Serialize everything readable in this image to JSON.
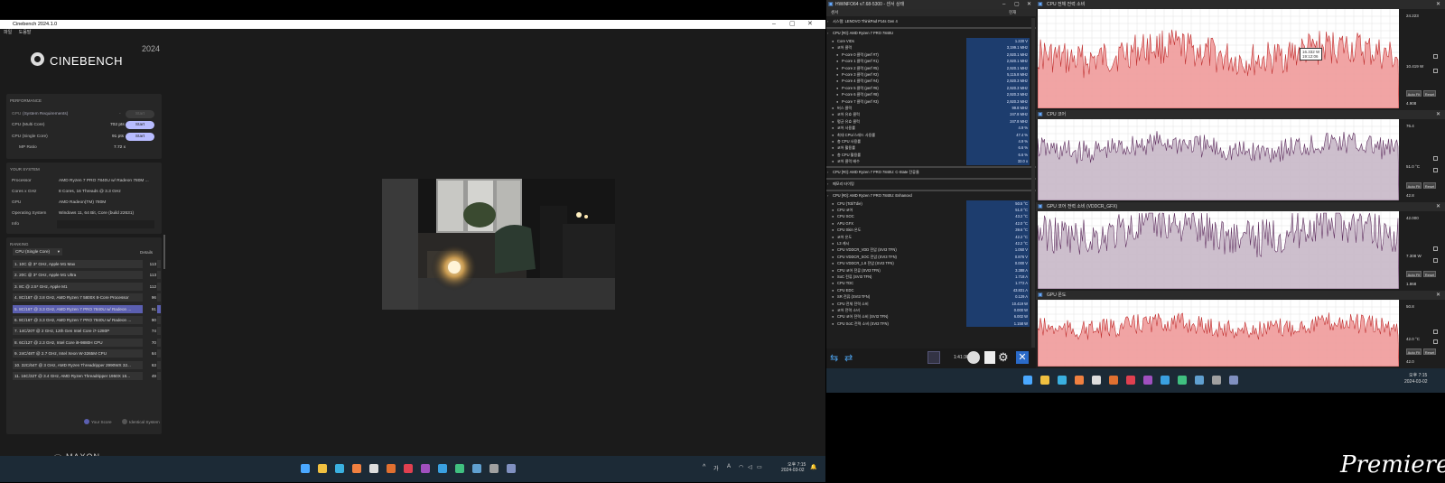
{
  "cinebench": {
    "title": "Cinebench 2024.1.0",
    "menu": [
      "파일",
      "도움말"
    ],
    "logo_text": "CINEBENCH",
    "logo_year": "2024",
    "performance": {
      "header": "PERFORMANCE",
      "gpu_label": "GPU",
      "gpu_req": "(System Requirements)",
      "gpu_val": "-",
      "multi_label": "CPU (Multi Core)",
      "multi_val": "702 pts",
      "single_label": "CPU (Single Core)",
      "single_val": "91 pts",
      "mp_label": "MP Ratio",
      "mp_val": "7.72 x",
      "start": "Start"
    },
    "system": {
      "header": "YOUR SYSTEM",
      "rows": [
        {
          "k": "Processor",
          "v": "AMD Ryzen 7 PRO 7840U w/ Radeon 780M ..."
        },
        {
          "k": "Cores x GHz",
          "v": "8 Cores, 16 Threads @ 3.3 GHz"
        },
        {
          "k": "GPU",
          "v": "AMD Radeon(TM) 780M"
        },
        {
          "k": "Operating System",
          "v": "Windows 11, 64 Bit, Core (build 22631)"
        },
        {
          "k": "Info",
          "v": ""
        }
      ]
    },
    "ranking": {
      "header": "RANKING",
      "select": "CPU (Single Core)",
      "details": "Details",
      "items": [
        {
          "label": "1. 10C @ 3* GHz, Apple M1 Max",
          "score": "113",
          "hl": false
        },
        {
          "label": "2. 20C @ 3* GHz, Apple M1 Ultra",
          "score": "113",
          "hl": false
        },
        {
          "label": "3. 8C @ 2.5* GHz, Apple M1",
          "score": "112",
          "hl": false
        },
        {
          "label": "4. 8C/16T @ 3.8 GHz, AMD Ryzen 7 5800X 8-Core Processor",
          "score": "96",
          "hl": false
        },
        {
          "label": "5. 8C/16T @ 3.3 GHz, AMD Ryzen 7 PRO 7840U w/ Radeon ...",
          "score": "91",
          "hl": true
        },
        {
          "label": "6. 8C/16T @ 3.3 GHz, AMD Ryzen 7 PRO 7840U w/ Radeon ...",
          "score": "90",
          "hl": false
        },
        {
          "label": "7. 14C/20T @ 2 GHz, 12th Gen Intel Core i7-1280P",
          "score": "74",
          "hl": false
        },
        {
          "label": "8. 6C/12T @ 2.3 GHz, Intel Core i9-9880H CPU",
          "score": "70",
          "hl": false
        },
        {
          "label": "9. 24C/48T @ 2.7 GHz, Intel Xeon W-3265M CPU",
          "score": "64",
          "hl": false
        },
        {
          "label": "10. 32C/64T @ 3 GHz, AMD Ryzen Threadripper 2990WX 32...",
          "score": "63",
          "hl": false
        },
        {
          "label": "11. 16C/32T @ 3.4 GHz, AMD Ryzen Threadripper 1950X 16...",
          "score": "49",
          "hl": false
        }
      ],
      "legend_your": "Your Score",
      "legend_identical": "Identical System"
    },
    "maxon": "MAXON"
  },
  "taskbar_left": {
    "time": "오후 7:15",
    "date": "2024-03-02",
    "tray": [
      "^",
      "가",
      "A"
    ]
  },
  "hwinfo": {
    "title": "HWiNFO64 v7.68-5300 - 센서 상태",
    "col_sensor": "센서",
    "col_current": "현재",
    "rows": [
      {
        "n": "시스템: LENOVO ThinkPad P14s Gen 4",
        "v": "",
        "grp": true,
        "ind": 0
      },
      {
        "n": "CPU [#0]: AMD Ryzen 7 PRO 7840U",
        "v": "",
        "grp": true,
        "ind": 0
      },
      {
        "n": "Core VIDs",
        "v": "1.220 V",
        "ind": 1
      },
      {
        "n": "코어 클럭",
        "v": "3,199.1 MHz",
        "ind": 1
      },
      {
        "n": "P-core 0 클럭 (perf #7)",
        "v": "2,920.1 MHz",
        "ind": 2
      },
      {
        "n": "P-core 1 클럭 (perf #1)",
        "v": "2,920.1 MHz",
        "ind": 2
      },
      {
        "n": "P-core 2 클럭 (perf #5)",
        "v": "2,920.1 MHz",
        "ind": 2
      },
      {
        "n": "P-core 3 클럭 (perf #2)",
        "v": "5,115.8 MHz",
        "ind": 2
      },
      {
        "n": "P-core 4 클럭 (perf #4)",
        "v": "2,920.3 MHz",
        "ind": 2
      },
      {
        "n": "P-core 5 클럭 (perf #6)",
        "v": "2,920.3 MHz",
        "ind": 2
      },
      {
        "n": "P-core 6 클럭 (perf #8)",
        "v": "2,920.3 MHz",
        "ind": 2
      },
      {
        "n": "P-core 7 클럭 (perf #3)",
        "v": "2,920.3 MHz",
        "ind": 2
      },
      {
        "n": "버스 클럭",
        "v": "99.8 MHz",
        "ind": 1
      },
      {
        "n": "코어 유효 클럭",
        "v": "247.8 MHz",
        "ind": 1
      },
      {
        "n": "평균 유효 클럭",
        "v": "247.8 MHz",
        "ind": 1
      },
      {
        "n": "코어 사용률",
        "v": "4.9 %",
        "ind": 1
      },
      {
        "n": "최대 CPU/스레드 사용률",
        "v": "47.4 %",
        "ind": 1
      },
      {
        "n": "총 CPU 사용률",
        "v": "4.9 %",
        "ind": 1
      },
      {
        "n": "코어 활용률",
        "v": "6.6 %",
        "ind": 1
      },
      {
        "n": "총 CPU 활용률",
        "v": "6.6 %",
        "ind": 1
      },
      {
        "n": "코어 클럭 배수",
        "v": "32.0 x",
        "ind": 1
      },
      {
        "n": "CPU [#0]: AMD Ryzen 7 PRO 7840U: C-State 잔류율",
        "v": "",
        "grp": true,
        "ind": 0
      },
      {
        "n": "메모리 타이밍",
        "v": "",
        "grp": true,
        "ind": 0
      },
      {
        "n": "CPU [#0]: AMD Ryzen 7 PRO 7840U: Enhanced",
        "v": "",
        "grp": true,
        "ind": 0
      },
      {
        "n": "CPU (Tctl/Tdie)",
        "v": "50.5 °C",
        "ind": 1
      },
      {
        "n": "CPU 코어",
        "v": "51.0 °C",
        "ind": 1
      },
      {
        "n": "CPU SOC",
        "v": "43.2 °C",
        "ind": 1
      },
      {
        "n": "APU GFX",
        "v": "42.0 °C",
        "ind": 1
      },
      {
        "n": "CPU Skin 온도",
        "v": "39.6 °C",
        "ind": 1
      },
      {
        "n": "코어 온도",
        "v": "42.2 °C",
        "ind": 1
      },
      {
        "n": "L3 캐시",
        "v": "42.2 °C",
        "ind": 1
      },
      {
        "n": "CPU VDDCR_VDD 전압 (SVI3 TFN)",
        "v": "1.050 V",
        "ind": 1
      },
      {
        "n": "CPU VDDCR_SOC 전압 (SVI3 TFN)",
        "v": "0.876 V",
        "ind": 1
      },
      {
        "n": "CPU VDDCR_1.8 전압 (SVI3 TFN)",
        "v": "0.000 V",
        "ind": 1
      },
      {
        "n": "CPU 코어 전류 (SVI3 TFN)",
        "v": "3.388 A",
        "ind": 1
      },
      {
        "n": "SoC 전류 (SVI3 TFN)",
        "v": "1.718 A",
        "ind": 1
      },
      {
        "n": "CPU TDC",
        "v": "1.772 A",
        "ind": 1
      },
      {
        "n": "CPU EDC",
        "v": "43.831 A",
        "ind": 1
      },
      {
        "n": "SR 전류 (SVI3 TFN)",
        "v": "0.129 A",
        "ind": 1
      },
      {
        "n": "CPU 전체 전력 소비",
        "v": "10.419 W",
        "ind": 1
      },
      {
        "n": "코어 전력 소비",
        "v": "0.000 W",
        "ind": 1
      },
      {
        "n": "CPU 코어 전력 소비 (SVI3 TFN)",
        "v": "6.002 W",
        "ind": 1
      },
      {
        "n": "CPU SoC 전력 소비 (SVI3 TFN)",
        "v": "1.158 W",
        "ind": 1
      }
    ],
    "timer": "1:41:36"
  },
  "graphs": [
    {
      "title": "CPU 전체 전력 소비",
      "max": "24.223",
      "cur": "10.419 W",
      "min": "4.908",
      "tooltip_v": "16.332 W",
      "tooltip_t": "19:12:06",
      "color": "#f09a9a"
    },
    {
      "title": "CPU 코어",
      "max": "76.4",
      "cur": "51.0 °C",
      "min": "42.8",
      "color": "#c8b8c8"
    },
    {
      "title": "GPU 코어 전력 소비 (VDDCR_GFX)",
      "max": "42.000",
      "cur": "7.308 W",
      "min": "1.868",
      "color": "#c8b8c8"
    },
    {
      "title": "GPU 온도",
      "max": "50.8",
      "cur": "42.0 °C",
      "min": "42.0",
      "color": "#f09a9a"
    }
  ],
  "graph_buttons": {
    "auto_fit": "Auto Fit",
    "reset": "Reset"
  },
  "taskbar_right": {
    "time": "오후 7:15",
    "date": "2024-03-02"
  },
  "watermark": "Premiere"
}
